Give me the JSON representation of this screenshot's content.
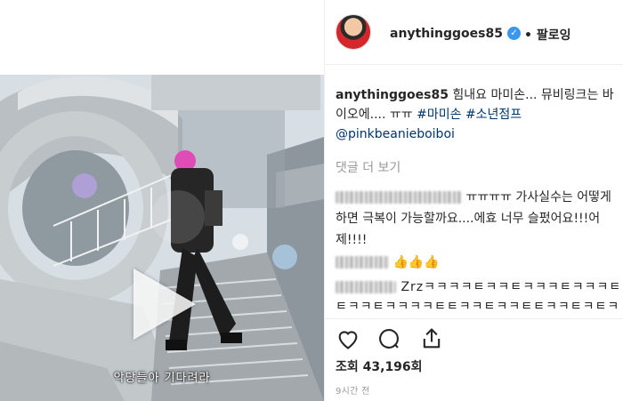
{
  "video": {
    "subtitle": "악당들아 기다려라"
  },
  "header": {
    "username": "anythinggoes85",
    "verified_mark": "✓",
    "follow_label": "• 팔로잉"
  },
  "caption": {
    "username": "anythinggoes85",
    "text_1": "힘내요 마미손... 뮤비링크는 바이오에.... ㅠㅠ",
    "hashtag_1": "#마미손",
    "hashtag_2": "#소년점프",
    "mention": "@pinkbeanieboiboi"
  },
  "view_more_comments": "댓글 더 보기",
  "comments": [
    {
      "text": "ㅠㅠㅠㅠ 가사실수는 어떻게하면 극복이 가능할까요....에효 너무 슬펐어요!!!어제!!!!"
    },
    {
      "text": "👍👍👍"
    },
    {
      "text": "Zrzㅋㅋㅋㅋㅌㅋㅋㅌㅋㅋㅋㅌㅋㅋㅋㅌㅌㅋㅋㅌㅋㅋㅋㅋㅌㅌㅋㅋㅌㅋㅋㅌㅌㅋㅋㅌㅋㅌㅋ"
    }
  ],
  "actions": {
    "like_icon": "heart-icon",
    "comment_icon": "comment-icon",
    "share_icon": "share-icon"
  },
  "stats": {
    "views_label": "조회",
    "views_count": "43,196회"
  },
  "timestamp": "9시간 전"
}
